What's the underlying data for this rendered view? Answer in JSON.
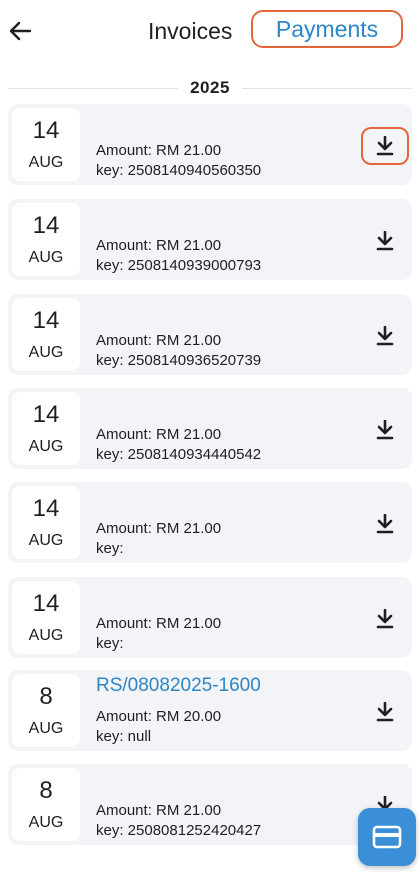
{
  "header": {
    "back_icon": "arrow-left-icon",
    "tab_invoices": "Invoices",
    "tab_payments": "Payments",
    "active_tab": "Payments"
  },
  "year_label": "2025",
  "colors": {
    "accent": "#2f86c6",
    "highlight": "#e2683c",
    "card_bg": "#f2f4f7",
    "fab": "#3a8fd6"
  },
  "payments": [
    {
      "day": "14",
      "month": "AUG",
      "ref": "",
      "amount": "Amount: RM 21.00",
      "key": "key: 2508140940560350",
      "icon": "download-icon"
    },
    {
      "day": "14",
      "month": "AUG",
      "ref": "",
      "amount": "Amount: RM 21.00",
      "key": "key: 2508140939000793",
      "icon": "download-icon"
    },
    {
      "day": "14",
      "month": "AUG",
      "ref": "",
      "amount": "Amount: RM 21.00",
      "key": "key: 2508140936520739",
      "icon": "download-icon"
    },
    {
      "day": "14",
      "month": "AUG",
      "ref": "",
      "amount": "Amount: RM 21.00",
      "key": "key: 2508140934440542",
      "icon": "download-icon"
    },
    {
      "day": "14",
      "month": "AUG",
      "ref": "",
      "amount": "Amount: RM 21.00",
      "key": "key:",
      "icon": "download-icon"
    },
    {
      "day": "14",
      "month": "AUG",
      "ref": "",
      "amount": "Amount: RM 21.00",
      "key": "key:",
      "icon": "download-icon"
    },
    {
      "day": "8",
      "month": "AUG",
      "ref": "RS/08082025-1600",
      "amount": "Amount: RM 20.00",
      "key": "key: null",
      "icon": "download-icon"
    },
    {
      "day": "8",
      "month": "AUG",
      "ref": "",
      "amount": "Amount: RM 21.00",
      "key": "key: 2508081252420427",
      "icon": "download-icon"
    }
  ],
  "fab_icon": "credit-card-icon"
}
